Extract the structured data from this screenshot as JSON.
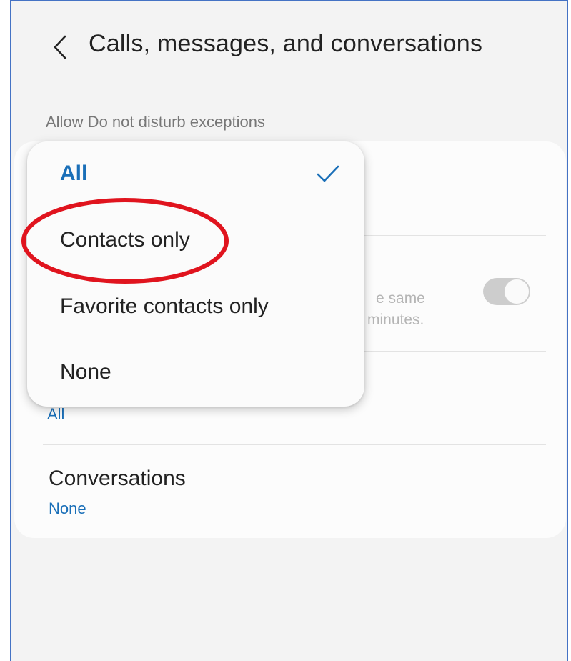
{
  "header": {
    "back_icon": "chevron-left-icon",
    "title": "Calls, messages, and conversations"
  },
  "section": {
    "label": "Allow Do not disturb exceptions"
  },
  "settings": {
    "repeat_caller_partial_line1": "e same",
    "repeat_caller_partial_line2": "minutes.",
    "repeat_caller_toggle_on": true,
    "messages_value": "All",
    "conversations_title": "Conversations",
    "conversations_value": "None"
  },
  "dropdown": {
    "options": [
      {
        "label": "All",
        "selected": true
      },
      {
        "label": "Contacts only",
        "selected": false
      },
      {
        "label": "Favorite contacts only",
        "selected": false
      },
      {
        "label": "None",
        "selected": false
      }
    ],
    "check_icon": "checkmark-icon"
  },
  "annotation": {
    "highlight_color": "#e0141e",
    "highlighted_option": "Contacts only"
  },
  "colors": {
    "accent": "#1a6fb8",
    "frame_border": "#4472c4",
    "background": "#f3f3f3"
  }
}
